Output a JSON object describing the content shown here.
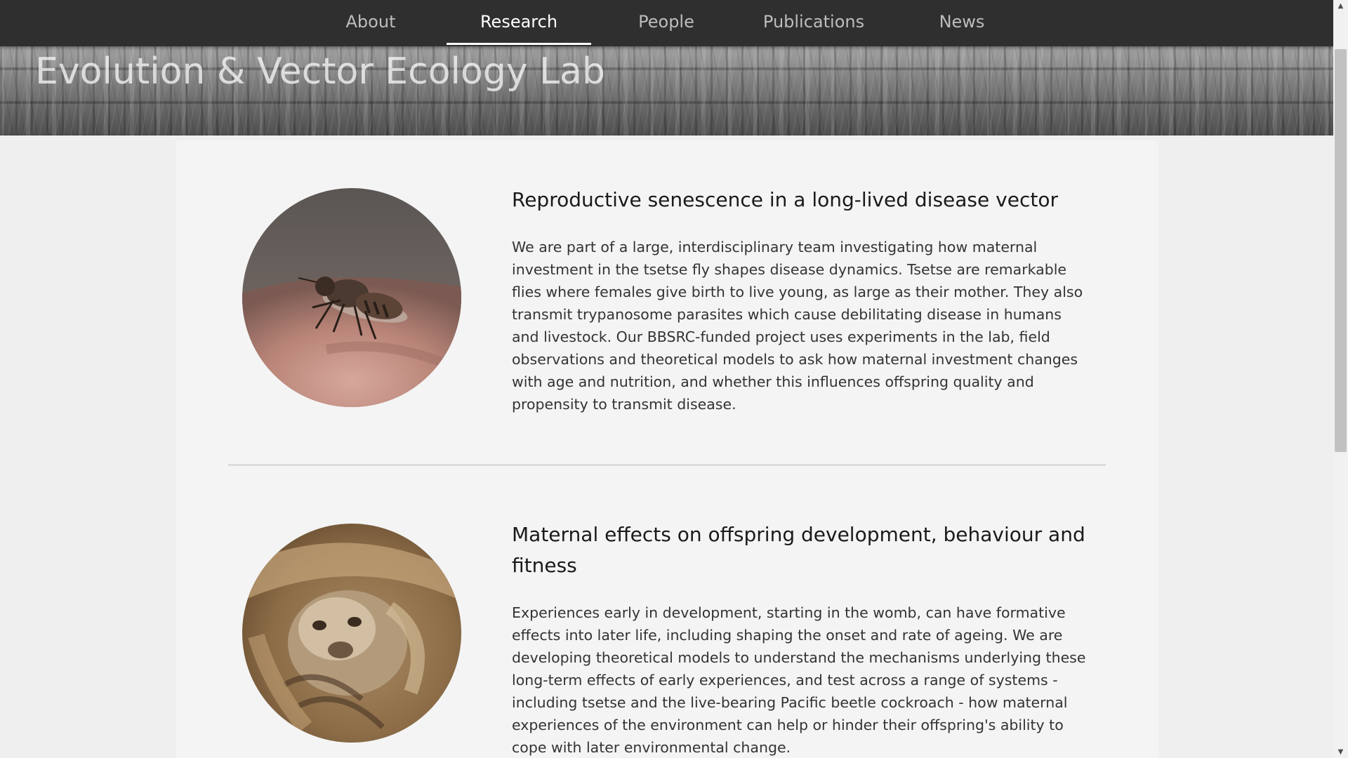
{
  "nav": {
    "items": [
      {
        "label": "About"
      },
      {
        "label": "Research"
      },
      {
        "label": "People"
      },
      {
        "label": "Publications"
      },
      {
        "label": "News"
      }
    ],
    "active": "Research"
  },
  "header": {
    "site_title": "Evolution & Vector Ecology Lab"
  },
  "research": [
    {
      "title": "Reproductive senescence in a long-lived disease vector",
      "body": "We are part of a large, interdisciplinary team investigating how maternal investment in the tsetse fly shapes disease dynamics. Tsetse are remarkable flies where females give birth to live young, as large as their mother. They also transmit trypanosome parasites which cause debilitating disease in humans and livestock. Our BBSRC-funded project uses experiments in the lab, field observations and theoretical models to ask how maternal investment changes with age and nutrition, and whether this influences offspring quality and propensity to transmit disease.",
      "image_subject": "tsetse-fly"
    },
    {
      "title": "Maternal effects on offspring development, behaviour and fitness",
      "body": "Experiences early in development, starting in the womb, can have formative effects into later life, including shaping the onset and rate of ageing. We are developing theoretical models to understand the mechanisms underlying these long-term effects of early experiences, and test across a range of systems - including tsetse and the live-bearing Pacific beetle cockroach - how maternal experiences of the environment can help or hinder their offspring's ability to cope with later environmental change.",
      "image_subject": "meerkat-pup"
    }
  ],
  "scrollbar": {
    "up_arrow": "▲",
    "down_arrow": "▼"
  }
}
